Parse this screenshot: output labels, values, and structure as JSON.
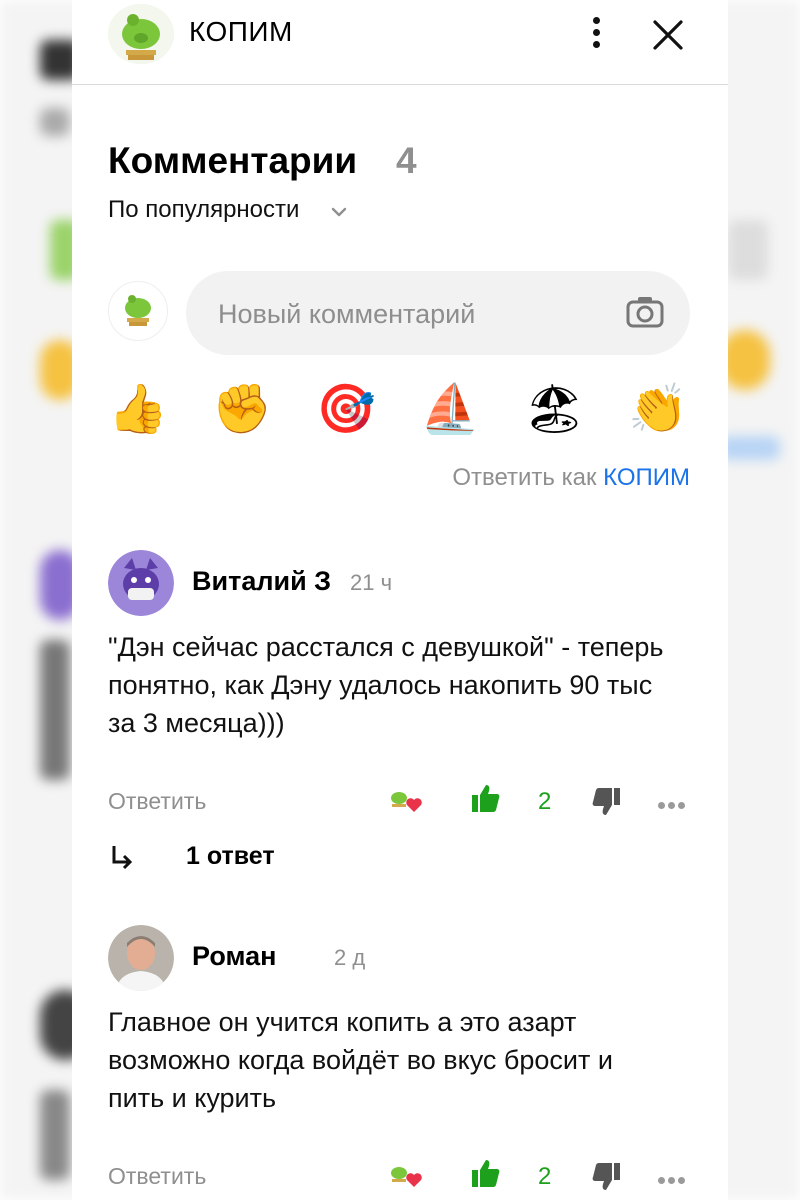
{
  "channel": {
    "name": "КОПИМ"
  },
  "comments_header": {
    "title": "Комментарии",
    "count": "4"
  },
  "sort": {
    "label": "По популярности"
  },
  "new_comment": {
    "placeholder": "Новый комментарий"
  },
  "quick_emojis": [
    "👍",
    "✊",
    "🎯",
    "⛵",
    "🏖",
    "👏"
  ],
  "reply_as": {
    "prefix": "Ответить как",
    "name": "КОПИМ"
  },
  "comments": [
    {
      "author": "Виталий З",
      "time": "21 ч",
      "text": "\"Дэн сейчас расстался с девушкой\" - теперь понятно, как Дэну удалось накопить 90 тыс за 3 месяца)))",
      "reply_label": "Ответить",
      "likes": "2",
      "replies_label": "1 ответ"
    },
    {
      "author": "Роман",
      "time": "2 д",
      "text": "Главное он учится копить а это азарт возможно когда войдёт во вкус бросит и пить и курить",
      "reply_label": "Ответить",
      "likes": "2"
    }
  ],
  "colors": {
    "accent_link": "#1a73e8",
    "like_green": "#1da11d",
    "muted": "#8f8f8f"
  },
  "icons": [
    "piggy-bank-avatar",
    "kebab-menu-icon",
    "close-icon",
    "chevron-down-icon",
    "camera-icon",
    "thumbs-up-icon",
    "thumbs-down-icon",
    "more-dots-icon",
    "reply-arrow-icon"
  ]
}
